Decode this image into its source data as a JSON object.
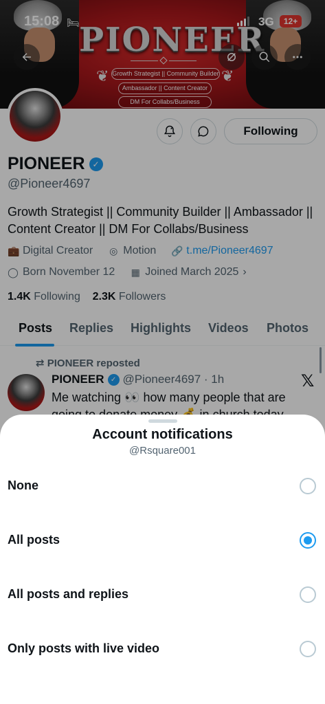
{
  "status_bar": {
    "time": "15:08",
    "network": "3G",
    "battery": "12+"
  },
  "banner": {
    "title": "PIONEER",
    "tag1": "Growth Strategist || Community Builder",
    "tag2": "Ambassador || Content Creator",
    "tag3": "DM For Collabs/Business"
  },
  "profile": {
    "name": "PIONEER",
    "handle": "@Pioneer4697",
    "bio": "Growth Strategist || Community Builder || Ambassador || Content Creator || DM For Collabs/Business",
    "category": "Digital Creator",
    "location": "Motion",
    "link": "t.me/Pioneer4697",
    "birthday": "Born November 12",
    "joined": "Joined March 2025",
    "following_count": "1.4K",
    "following_label": "Following",
    "followers_count": "2.3K",
    "followers_label": "Followers",
    "following_button": "Following"
  },
  "tabs": [
    "Posts",
    "Replies",
    "Highlights",
    "Videos",
    "Photos"
  ],
  "post": {
    "repost_label": "PIONEER reposted",
    "author": "PIONEER",
    "handle_time": "@Pioneer4697 · 1h",
    "text": "Me watching 👀 how many people that are going to donate money 💰 in church today"
  },
  "sheet": {
    "title": "Account notifications",
    "subtitle": "@Rsquare001",
    "options": [
      {
        "label": "None",
        "selected": false
      },
      {
        "label": "All posts",
        "selected": true
      },
      {
        "label": "All posts and replies",
        "selected": false
      },
      {
        "label": "Only posts with live video",
        "selected": false
      }
    ]
  },
  "colors": {
    "accent": "#1d9bf0",
    "banner_red": "#a8171b",
    "battery_red": "#e0352e"
  }
}
